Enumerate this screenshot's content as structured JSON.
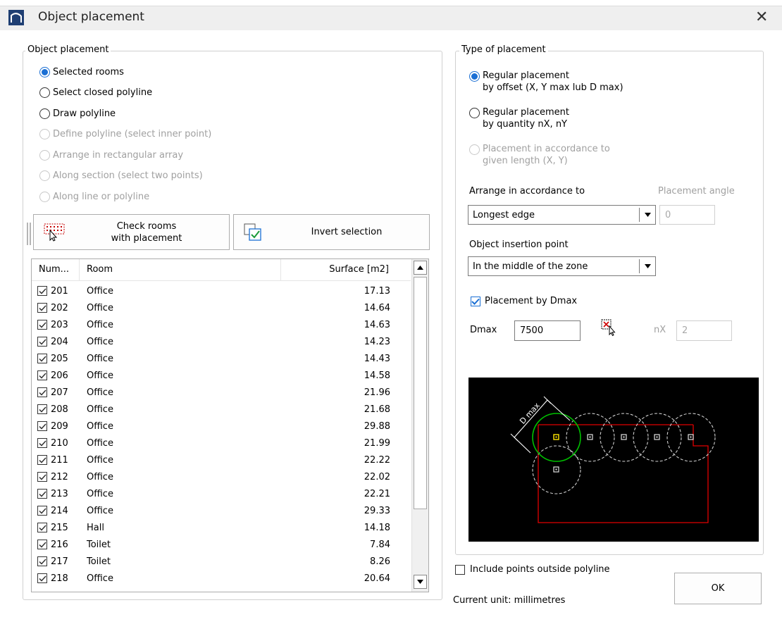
{
  "window": {
    "title": "Object placement",
    "close_glyph": "✕"
  },
  "placement_group": {
    "label": "Object placement",
    "options": [
      {
        "label": "Selected rooms",
        "checked": true,
        "disabled": false
      },
      {
        "label": "Select closed polyline",
        "checked": false,
        "disabled": false
      },
      {
        "label": "Draw polyline",
        "checked": false,
        "disabled": false
      },
      {
        "label": "Define polyline (select inner point)",
        "checked": false,
        "disabled": true
      },
      {
        "label": "Arrange in rectangular array",
        "checked": false,
        "disabled": true
      },
      {
        "label": "Along section (select two points)",
        "checked": false,
        "disabled": true
      },
      {
        "label": "Along line or polyline",
        "checked": false,
        "disabled": true
      }
    ]
  },
  "buttons": {
    "check_rooms_line1": "Check rooms",
    "check_rooms_line2": "with placement",
    "invert_selection": "Invert selection",
    "ok": "OK"
  },
  "rooms_table": {
    "headers": {
      "num": "Num...",
      "room": "Room",
      "surface": "Surface [m2]"
    },
    "rows": [
      {
        "num": "201",
        "room": "Office",
        "surface": "17.13"
      },
      {
        "num": "202",
        "room": "Office",
        "surface": "14.64"
      },
      {
        "num": "203",
        "room": "Office",
        "surface": "14.63"
      },
      {
        "num": "204",
        "room": "Office",
        "surface": "14.23"
      },
      {
        "num": "205",
        "room": "Office",
        "surface": "14.43"
      },
      {
        "num": "206",
        "room": "Office",
        "surface": "14.58"
      },
      {
        "num": "207",
        "room": "Office",
        "surface": "21.96"
      },
      {
        "num": "208",
        "room": "Office",
        "surface": "21.68"
      },
      {
        "num": "209",
        "room": "Office",
        "surface": "29.88"
      },
      {
        "num": "210",
        "room": "Office",
        "surface": "21.99"
      },
      {
        "num": "211",
        "room": "Office",
        "surface": "22.22"
      },
      {
        "num": "212",
        "room": "Office",
        "surface": "22.02"
      },
      {
        "num": "213",
        "room": "Office",
        "surface": "22.21"
      },
      {
        "num": "214",
        "room": "Office",
        "surface": "29.33"
      },
      {
        "num": "215",
        "room": "Hall",
        "surface": "14.18"
      },
      {
        "num": "216",
        "room": "Toilet",
        "surface": "7.84"
      },
      {
        "num": "217",
        "room": "Toilet",
        "surface": "8.26"
      },
      {
        "num": "218",
        "room": "Office",
        "surface": "20.64"
      }
    ]
  },
  "type_group": {
    "label": "Type of placement",
    "options": [
      {
        "line1": "Regular placement",
        "line2": "by offset (X, Y max lub D max)",
        "checked": true,
        "disabled": false
      },
      {
        "line1": "Regular placement",
        "line2": "by quantity nX, nY",
        "checked": false,
        "disabled": false
      },
      {
        "line1": "Placement in accordance to",
        "line2": "given length (X, Y)",
        "checked": false,
        "disabled": true
      }
    ],
    "arrange_label": "Arrange in accordance to",
    "arrange_value": "Longest edge",
    "angle_label": "Placement angle",
    "angle_value": "0",
    "insertion_label": "Object insertion point",
    "insertion_value": "In the middle of the zone",
    "dmax_checkbox_label": "Placement by Dmax",
    "dmax_checked": true,
    "dmax_label": "Dmax",
    "dmax_value": "7500",
    "nx_label": "nX",
    "nx_value": "2"
  },
  "preview": {
    "dimension_label": "D max"
  },
  "footer": {
    "include_outside_label": "Include points outside polyline",
    "include_outside_checked": false,
    "current_unit": "Current unit: millimetres"
  },
  "colors": {
    "accent": "#1a6fd4",
    "preview_bg": "#000000",
    "zone_outline": "#e00000",
    "active_circle": "#00c000",
    "marker_active": "#ffe600"
  }
}
